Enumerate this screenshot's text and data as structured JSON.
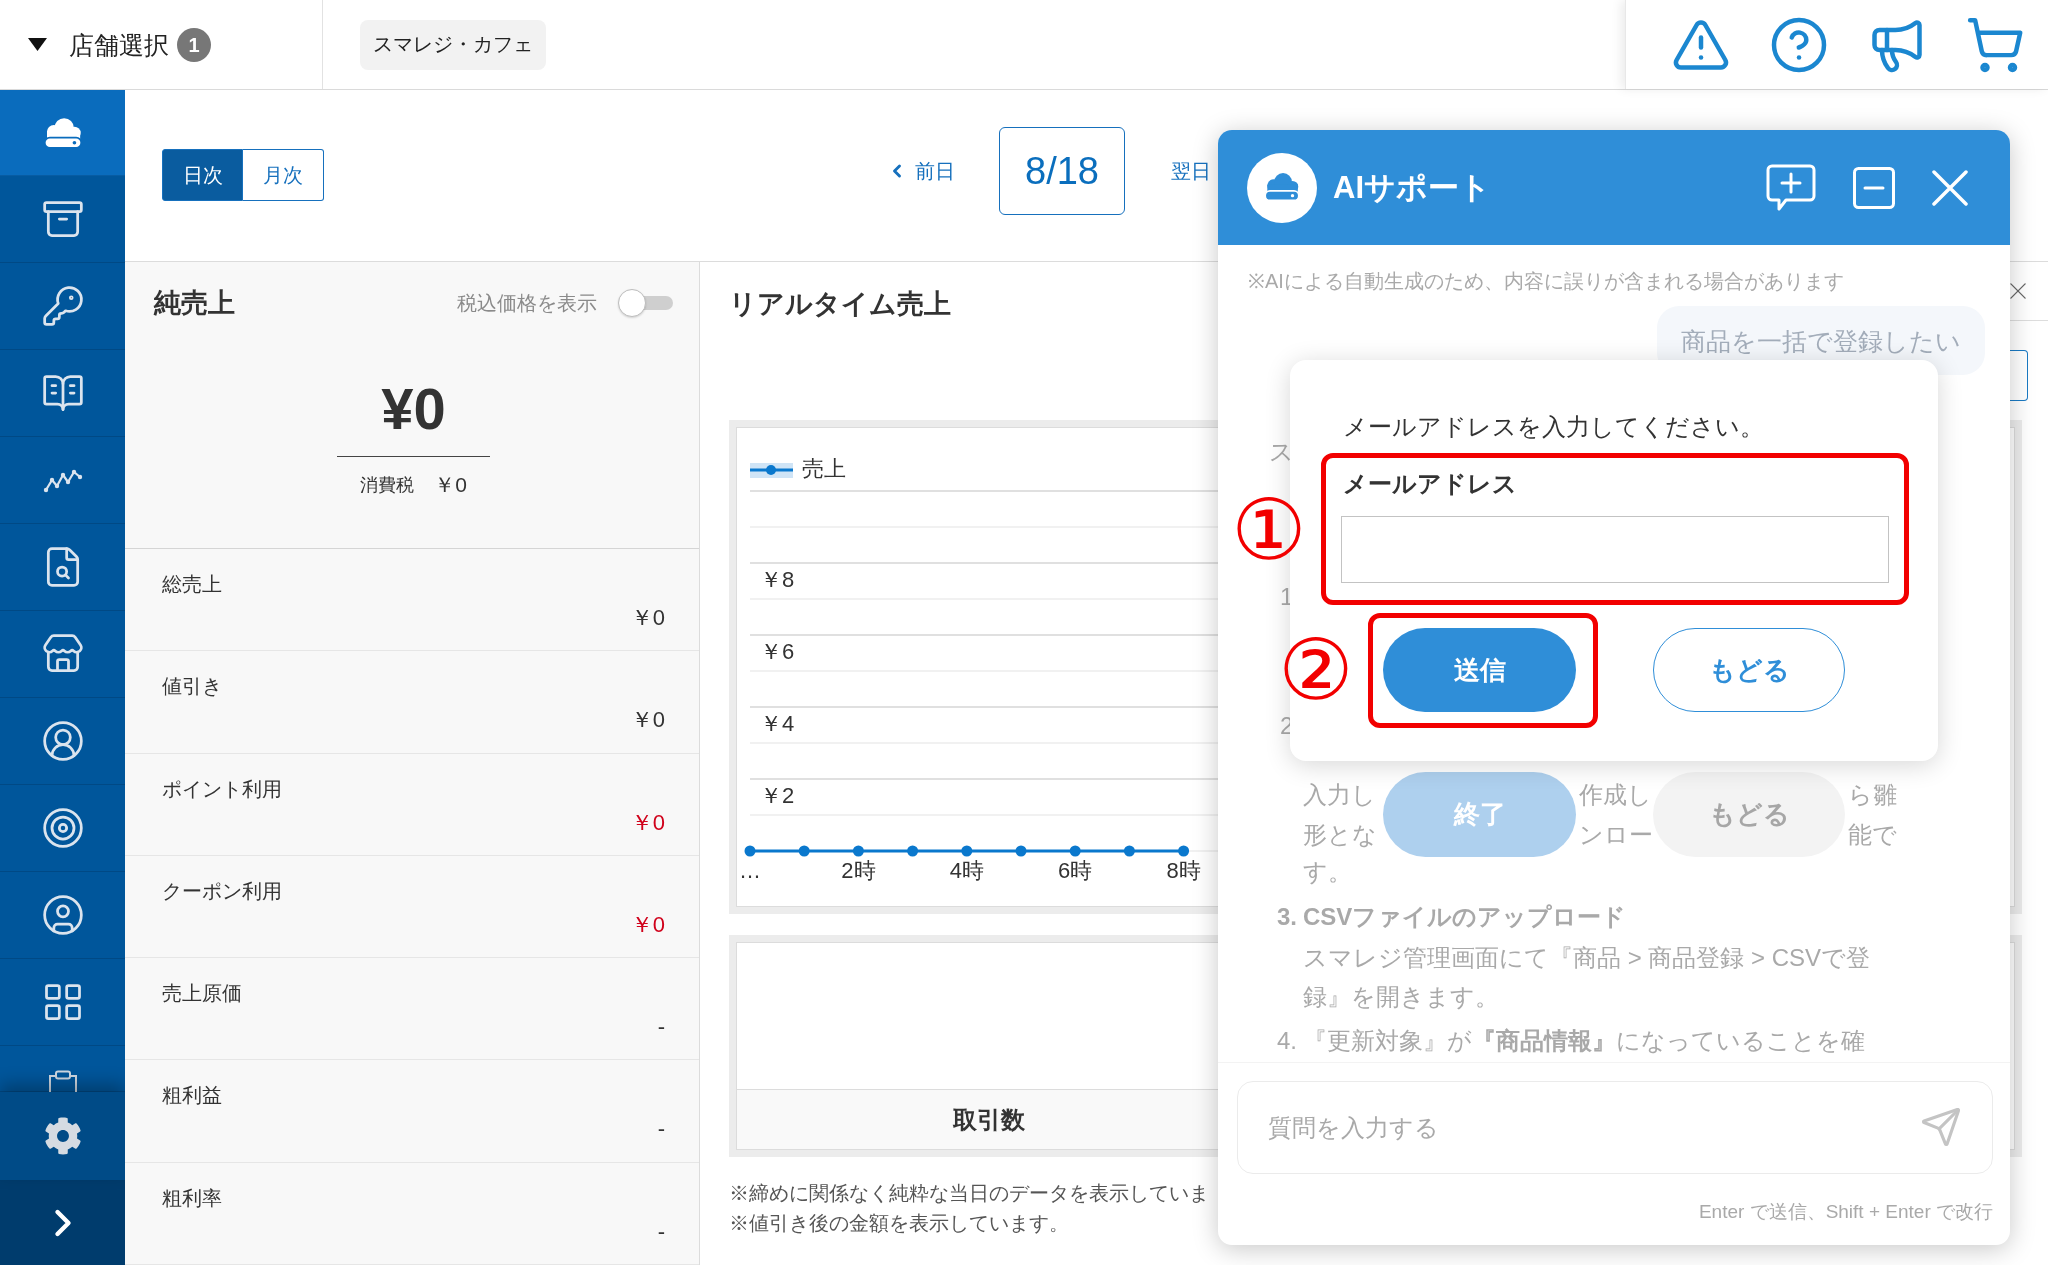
{
  "top_bar": {
    "store_selector": {
      "label": "店舗選択",
      "count": "1"
    },
    "current_store": "スマレジ・カフェ"
  },
  "sidebar": {
    "items": [
      {
        "selected": true
      },
      {
        "selected": false
      },
      {
        "selected": false
      },
      {
        "selected": false
      },
      {
        "selected": false
      },
      {
        "selected": false
      },
      {
        "selected": false
      },
      {
        "selected": false
      },
      {
        "selected": false
      },
      {
        "selected": false
      },
      {
        "selected": false
      },
      {
        "selected": false
      }
    ]
  },
  "period_tabs": [
    {
      "label": "日次",
      "selected": true
    },
    {
      "label": "月次",
      "selected": false
    }
  ],
  "date_nav": {
    "previous": "前日",
    "date": "8/18",
    "next": "翌日"
  },
  "net_sales": {
    "title": "純売上",
    "tax_toggle": {
      "label": "税込価格を表示",
      "on": false
    },
    "amount": "¥0",
    "tax": {
      "label": "消費税",
      "value": "￥0"
    },
    "rows": [
      {
        "label": "総売上",
        "value": "￥0",
        "color": "#333333"
      },
      {
        "label": "値引き",
        "value": "￥0",
        "color": "#333333"
      },
      {
        "label": "ポイント利用",
        "value": "￥0",
        "color": "#d0021b"
      },
      {
        "label": "クーポン利用",
        "value": "￥0",
        "color": "#d0021b"
      },
      {
        "label": "売上原価",
        "value": "-",
        "color": "#333333"
      },
      {
        "label": "粗利益",
        "value": "-",
        "color": "#333333"
      },
      {
        "label": "粗利率",
        "value": "-",
        "color": "#333333"
      }
    ]
  },
  "realtime_sales": {
    "title": "リアルタイム売上",
    "chart_data": {
      "type": "line",
      "x": [
        0,
        1,
        2,
        3,
        4,
        5,
        6,
        7,
        8
      ],
      "xlim": [
        0,
        23
      ],
      "xticks": [
        {
          "value": 0,
          "label": "…"
        },
        {
          "value": 2,
          "label": "2時"
        },
        {
          "value": 4,
          "label": "4時"
        },
        {
          "value": 6,
          "label": "6時"
        },
        {
          "value": 8,
          "label": "8時"
        }
      ],
      "ylim": [
        0,
        10
      ],
      "yticks": [
        {
          "value": 2,
          "label": "￥2"
        },
        {
          "value": 4,
          "label": "￥4"
        },
        {
          "value": 6,
          "label": "￥6"
        },
        {
          "value": 8,
          "label": "￥8"
        }
      ],
      "grid": true,
      "series": [
        {
          "name": "売上",
          "color": "#0a78cd",
          "marker": "circle",
          "values": [
            0,
            0,
            0,
            0,
            0,
            0,
            0,
            0,
            0
          ]
        }
      ]
    },
    "cards": [
      {
        "title": "取引数"
      }
    ],
    "notes": [
      "※締めに関係なく純粋な当日のデータを表示していま",
      "※値引き後の金額を表示しています。"
    ]
  },
  "ai_support": {
    "title": "AIサポート",
    "disclaimer": "※AIによる自動生成のため、内容に誤りが含まれる場合があります",
    "user_message": "商品を一括で登録したい",
    "answer": {
      "lead": "ス",
      "step_numbers": [
        "1",
        "2"
      ],
      "fragment_columns": [
        [
          "入力し",
          "形とな"
        ],
        [
          "作成し",
          "ンロー"
        ],
        [
          "ら雛",
          "能で"
        ]
      ],
      "buttons": [
        {
          "label": "終了",
          "kind": "primary"
        },
        {
          "label": "もどる",
          "kind": "secondary"
        }
      ],
      "line_end": "す。",
      "steps": [
        {
          "number": "3.",
          "title": "CSVファイルのアップロード",
          "text": "スマレジ管理画面にて『商品 > 商品登録 > CSVで登録』を開きます。"
        },
        {
          "number": "4.",
          "text": "『更新対象』が**『商品情報』**になっていることを確"
        }
      ]
    },
    "input": {
      "placeholder": "質問を入力する"
    },
    "hint": "Enter で送信、Shift + Enter で改行",
    "dialog": {
      "prompt": "メールアドレスを入力してください。",
      "field_label": "メールアドレス",
      "buttons": [
        {
          "label": "送信",
          "kind": "primary"
        },
        {
          "label": "もどる",
          "kind": "secondary"
        }
      ]
    },
    "annotations": [
      {
        "marker": "①"
      },
      {
        "marker": "②"
      }
    ]
  }
}
